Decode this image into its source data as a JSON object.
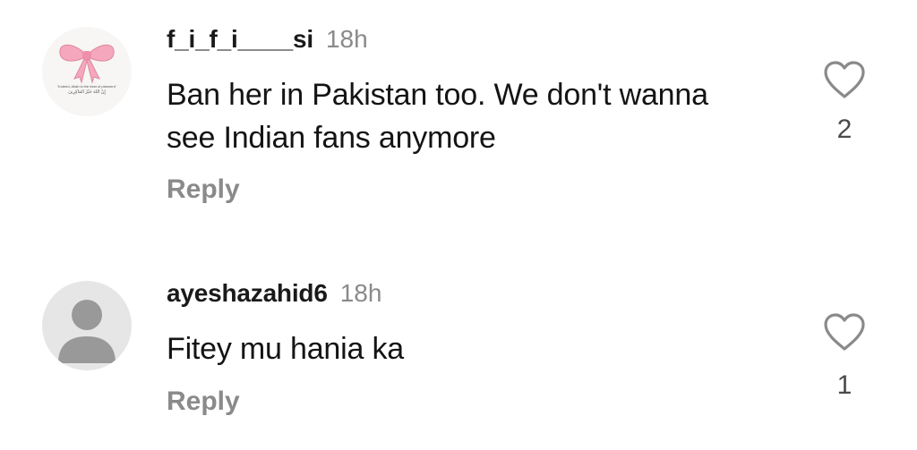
{
  "comments": [
    {
      "username": "f_i_f_i____si",
      "time": "18h",
      "text": "Ban her in Pakistan too. We don't wanna see Indian fans anymore",
      "reply_label": "Reply",
      "likes": "2",
      "avatar_tagline": "\"Indeed, Allah is the best of planners\"",
      "avatar_arabic": "إِنَّ اللَّهَ خَيْرُ الْمَاكِرِينَ"
    },
    {
      "username": "ayeshazahid6",
      "time": "18h",
      "text": "Fitey mu hania ka",
      "reply_label": "Reply",
      "likes": "1"
    }
  ],
  "icons": {
    "like": "heart-outline-icon",
    "default_avatar": "default-user-avatar-icon"
  },
  "colors": {
    "bow_pink": "#f2a0b7",
    "muted_text": "#8a8a8a",
    "avatar_gray": "#999999"
  }
}
